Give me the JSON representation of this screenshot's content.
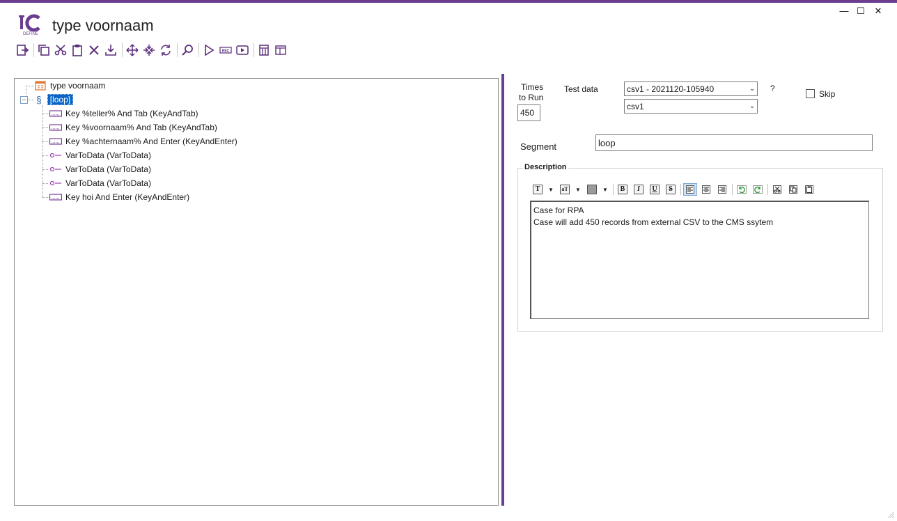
{
  "app": {
    "title": "type voornaam",
    "logo_text": "DEFINE"
  },
  "window": {
    "minimize": "—",
    "maximize": "☐",
    "close": "✕"
  },
  "toolbar": {
    "buttons": [
      "exit",
      "copy",
      "cut",
      "paste",
      "delete",
      "import",
      "move",
      "expand",
      "refresh",
      "search",
      "play",
      "record",
      "run",
      "data-settings",
      "window"
    ]
  },
  "tree": {
    "root": {
      "label": "type voornaam",
      "icon": "table-icon"
    },
    "group": {
      "label": "[loop]",
      "selected": true
    },
    "items": [
      {
        "label": "Key %teller% And Tab (KeyAndTab)",
        "icon": "keyboard-icon"
      },
      {
        "label": "Key %voornaam% And Tab (KeyAndTab)",
        "icon": "keyboard-icon"
      },
      {
        "label": "Key %achternaam% And Enter (KeyAndEnter)",
        "icon": "keyboard-icon"
      },
      {
        "label": "VarToData (VarToData)",
        "icon": "variable-icon"
      },
      {
        "label": "VarToData (VarToData)",
        "icon": "variable-icon"
      },
      {
        "label": "VarToData (VarToData)",
        "icon": "variable-icon"
      },
      {
        "label": "Key hoi And Enter (KeyAndEnter)",
        "icon": "keyboard-icon"
      }
    ]
  },
  "form": {
    "times_label_1": "Times",
    "times_label_2": "to Run",
    "times_value": "450",
    "testdata_label": "Test data",
    "testdata_value": "csv1 - 2021120-105940",
    "testdata2_value": "csv1",
    "help_label": "?",
    "skip_label": "Skip",
    "segment_label": "Segment",
    "segment_value": "loop",
    "description_label": "Description",
    "description_lines": [
      "Case for RPA",
      "",
      "Case will add 450 records from external CSV to the CMS ssytem"
    ]
  },
  "colors": {
    "accent": "#6a3d8f",
    "selection": "#0a64c8"
  }
}
